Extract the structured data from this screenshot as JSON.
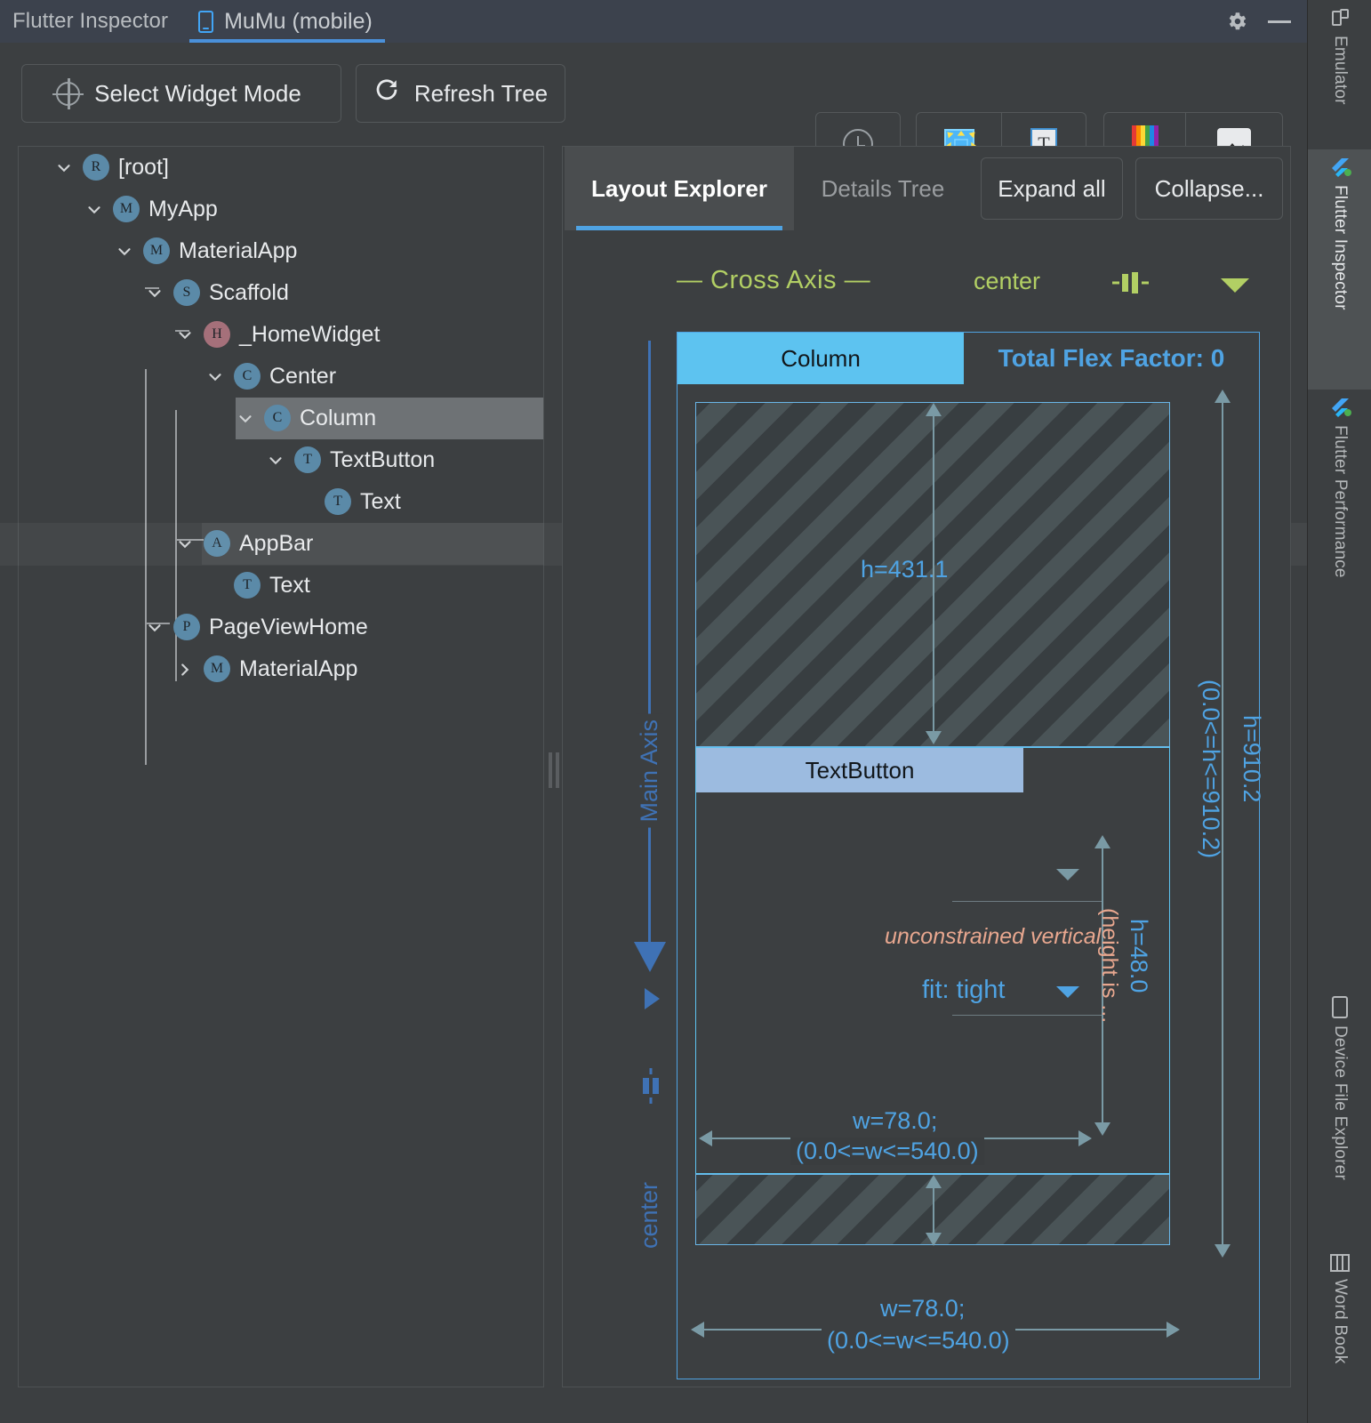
{
  "titlebar": {
    "app_title": "Flutter Inspector",
    "device_tab": "MuMu (mobile)",
    "device_icon": "phone-icon",
    "settings_icon": "gear-icon",
    "minimize_icon": "minimize-icon"
  },
  "toolbar": {
    "select_widget_mode": "Select Widget Mode",
    "refresh_tree": "Refresh Tree",
    "icons": {
      "select": "target-icon",
      "refresh": "refresh-icon",
      "slow_animations": "clock-icon",
      "debug_paint": "grid-select-icon",
      "paint_baselines": "text-baseline-icon",
      "highlight_repaints": "rainbow-icon",
      "invert_oversized_images": "image-icon"
    }
  },
  "toolstrip": {
    "items": [
      {
        "label": "Emulator",
        "icon": "emulator-icon",
        "active": false
      },
      {
        "label": "Flutter Inspector",
        "icon": "flutter-icon",
        "active": true
      },
      {
        "label": "Flutter Performance",
        "icon": "flutter-icon",
        "active": false
      },
      {
        "label": "Device File Explorer",
        "icon": "device-icon",
        "active": false
      },
      {
        "label": "Word Book",
        "icon": "book-icon",
        "active": false
      }
    ]
  },
  "widget_tree": {
    "nodes": [
      {
        "label": "[root]",
        "badge": "R",
        "depth": 0,
        "chevron": "down",
        "selected": false,
        "hovered": false
      },
      {
        "label": "MyApp",
        "badge": "M",
        "depth": 1,
        "chevron": "down",
        "selected": false,
        "hovered": false
      },
      {
        "label": "MaterialApp",
        "badge": "M",
        "depth": 2,
        "chevron": "down",
        "selected": false,
        "hovered": false
      },
      {
        "label": "Scaffold",
        "badge": "S",
        "depth": 3,
        "chevron": "down",
        "selected": false,
        "hovered": false
      },
      {
        "label": "_HomeWidget",
        "badge": "H",
        "depth": 4,
        "chevron": "down",
        "selected": false,
        "hovered": false
      },
      {
        "label": "Center",
        "badge": "C",
        "depth": 5,
        "chevron": "down",
        "selected": false,
        "hovered": false
      },
      {
        "label": "Column",
        "badge": "C",
        "depth": 6,
        "chevron": "down",
        "selected": true,
        "hovered": false
      },
      {
        "label": "TextButton",
        "badge": "T",
        "depth": 7,
        "chevron": "down",
        "selected": false,
        "hovered": false
      },
      {
        "label": "Text",
        "badge": "T",
        "depth": 8,
        "chevron": "none",
        "selected": false,
        "hovered": false
      },
      {
        "label": "AppBar",
        "badge": "A",
        "depth": 4,
        "chevron": "down",
        "selected": false,
        "hovered": true
      },
      {
        "label": "Text",
        "badge": "T",
        "depth": 5,
        "chevron": "none",
        "selected": false,
        "hovered": false
      },
      {
        "label": "PageViewHome",
        "badge": "P",
        "depth": 3,
        "chevron": "down",
        "selected": false,
        "hovered": false
      },
      {
        "label": "MaterialApp",
        "badge": "M",
        "depth": 4,
        "chevron": "right",
        "selected": false,
        "hovered": false
      }
    ]
  },
  "explorer": {
    "tabs": [
      {
        "label": "Layout Explorer",
        "active": true
      },
      {
        "label": "Details Tree",
        "active": false
      }
    ],
    "expand_all": "Expand all",
    "collapse_all": "Collapse...",
    "cross_axis": {
      "title": "— Cross Axis —",
      "alignment": "center",
      "icon": "cross-axis-center-icon",
      "dropdown_icon": "chevron-down-icon"
    },
    "main_axis": {
      "label": "Main Axis",
      "alignment": "center",
      "arrow_icon": "down-arrow-icon",
      "direction_icon": "play-icon",
      "distribution_icon": "main-axis-center-icon"
    },
    "column_box": {
      "name": "Column",
      "flex_factor": "Total Flex Factor: 0",
      "height_label": "h=910.2",
      "height_constraint": "(0.0<=h<=910.2)",
      "width_label": "w=78.0;",
      "width_constraint": "(0.0<=w<=540.0)"
    },
    "children": [
      {
        "kind": "spacer-top",
        "height_label": "h=431.1"
      },
      {
        "kind": "textbutton",
        "name": "TextButton",
        "height_label": "h=48.0",
        "height_constraint": "(height is ...",
        "width_label": "w=78.0;",
        "width_constraint": "(0.0<=w<=540.0)",
        "flex_note": "unconstrained vertical",
        "fit": "fit: tight",
        "fit_caret": "chevron-down-icon",
        "flex_caret": "chevron-down-icon"
      },
      {
        "kind": "spacer-bottom"
      }
    ]
  },
  "colors": {
    "accent_blue": "#4fa3e3",
    "column_chip": "#5dc3f0",
    "textbutton_chip": "#9cbbe0",
    "cross_axis_green": "#b2cf64",
    "main_axis_blue": "#3f72b5",
    "salmon": "#e8a78f",
    "panel_bg": "#3c3f41",
    "titlebar_bg": "#3c424d"
  }
}
